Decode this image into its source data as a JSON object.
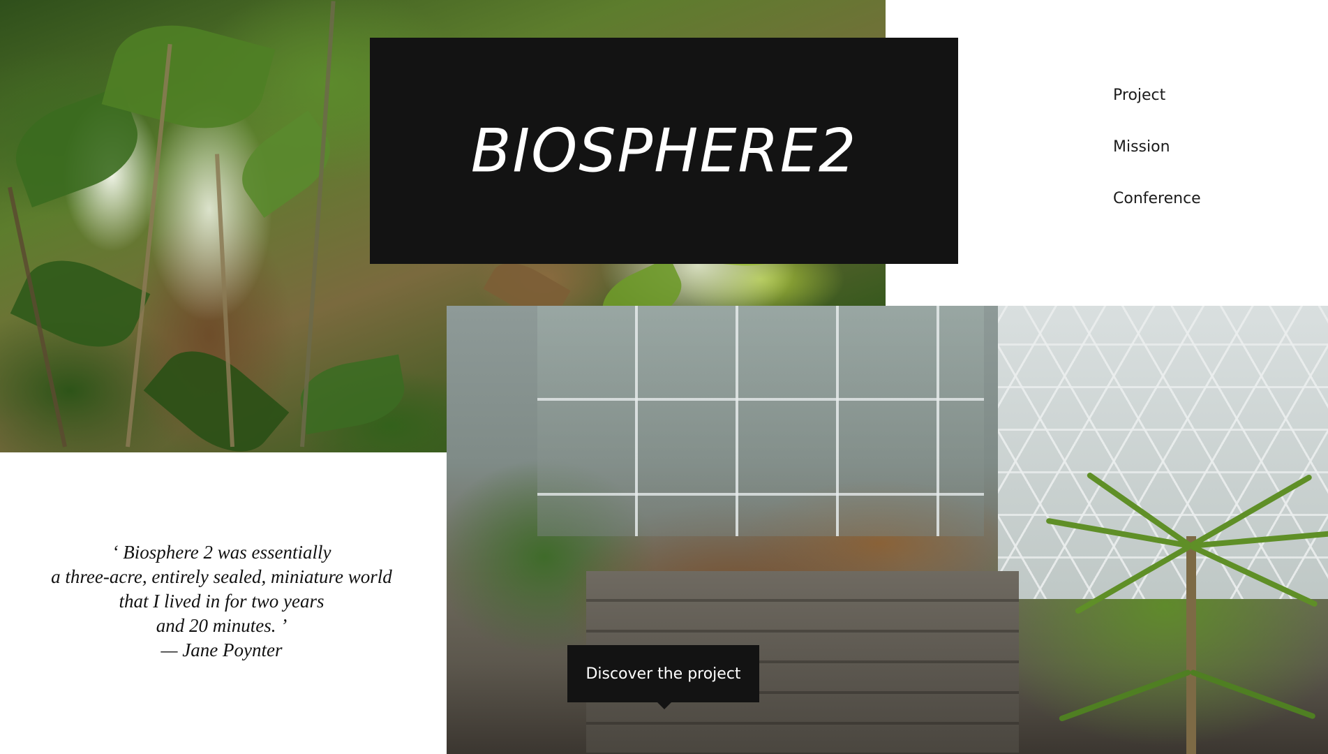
{
  "brand": {
    "title": "BIOSPHERE2"
  },
  "nav": {
    "items": [
      {
        "label": "Project"
      },
      {
        "label": "Mission"
      },
      {
        "label": "Conference"
      }
    ]
  },
  "quote": {
    "lines": [
      "‘ Biosphere 2 was essentially",
      "a three-acre, entirely sealed, miniature world",
      "that I lived in for two years",
      "and 20 minutes. ’",
      "— Jane Poynter"
    ]
  },
  "cta": {
    "label": "Discover the project"
  },
  "colors": {
    "title_bg": "#131313",
    "title_text": "#ffffff",
    "nav_text": "#1b1b1b",
    "page_bg": "#ffffff"
  }
}
